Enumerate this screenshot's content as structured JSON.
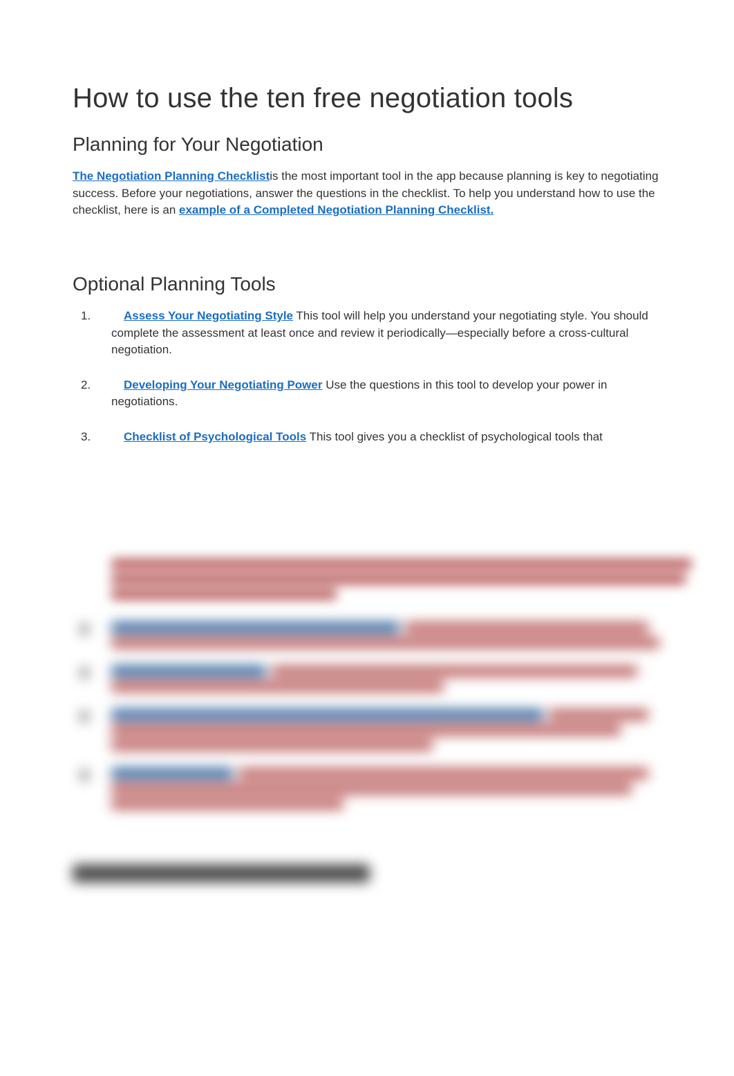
{
  "title": "How to use the ten free negotiation tools",
  "section1": {
    "heading": "Planning for Your Negotiation",
    "link1": "The Negotiation Planning Checklist",
    "text1a": "is the most important tool in the app because planning is key to negotiating success. Before your negotiations, answer the questions in the checklist. To help you understand how to use the checklist, here is an ",
    "link2": "example of a Completed Negotiation Planning Checklist."
  },
  "section2": {
    "heading": "Optional Planning Tools",
    "items": [
      {
        "link": "Assess Your Negotiating Style",
        "text": " This tool will help you understand your negotiating style. You should complete the assessment at least once and review it periodically—especially before a cross-cultural negotiation."
      },
      {
        "link": "Developing Your Negotiating Power",
        "text": " Use the questions in this tool to develop your power in negotiations."
      },
      {
        "link": "Checklist of Psychological Tools",
        "text": " This tool gives you a checklist of psychological tools that"
      }
    ]
  },
  "blurred": {
    "item3_lines": [
      {
        "w": "98%",
        "link": false
      },
      {
        "w": "97%",
        "link": false
      },
      {
        "w": "38%",
        "link": false
      }
    ],
    "items": [
      {
        "lines": [
          {
            "w1": "52%",
            "w2": "44%"
          },
          {
            "w": "99%"
          }
        ]
      },
      {
        "lines": [
          {
            "w1": "28%",
            "w2": "66%"
          },
          {
            "w": "60%"
          }
        ]
      },
      {
        "lines": [
          {
            "w1": "78%",
            "w2": "18%"
          },
          {
            "w": "92%"
          },
          {
            "w": "58%"
          }
        ]
      },
      {
        "lines": [
          {
            "w1": "22%",
            "w2": "74%"
          },
          {
            "w": "94%"
          },
          {
            "w": "42%"
          }
        ]
      }
    ],
    "heading": "Evaluating Your Performance"
  }
}
